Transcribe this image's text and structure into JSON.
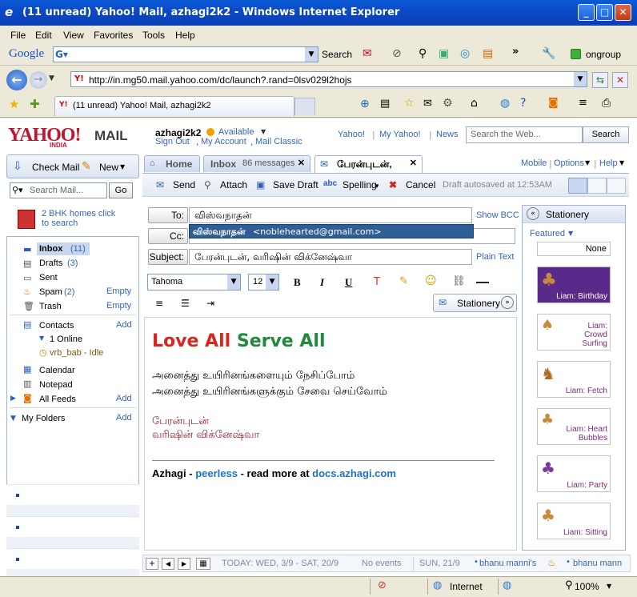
{
  "window": {
    "title": "(11 unread) Yahoo! Mail, azhagi2k2 - Windows Internet Explorer",
    "minimize": "_",
    "maximize": "□",
    "close": "✕"
  },
  "menu": [
    "File",
    "Edit",
    "View",
    "Favorites",
    "Tools",
    "Help"
  ],
  "googlebar": {
    "logo": "Google",
    "search_label": "Search",
    "more": "»",
    "ongroup": "ongroup"
  },
  "address": {
    "url": "http://in.mg50.mail.yahoo.com/dc/launch?.rand=0lsv029l2hojs"
  },
  "tabtitle": "(11 unread) Yahoo! Mail, azhagi2k2",
  "yahoo": {
    "logo": "YAHOO!",
    "logo_sub": "INDIA",
    "mail": "MAIL",
    "user": "azhagi2k2",
    "status": "Available",
    "links": [
      "Sign Out",
      "My Account",
      "Mail Classic"
    ],
    "top_links": [
      "Yahoo!",
      "My Yahoo!",
      "News"
    ],
    "search_placeholder": "Search the Web...",
    "search_btn": "Search"
  },
  "left": {
    "check_mail": "Check Mail",
    "new": "New",
    "search_placeholder": "Search Mail...",
    "go": "Go",
    "ad_line1": "2 BHK homes click",
    "ad_line2": "to search",
    "folders": [
      {
        "name": "Inbox",
        "count": "(11)"
      },
      {
        "name": "Drafts",
        "count": "(3)"
      },
      {
        "name": "Sent",
        "count": ""
      },
      {
        "name": "Spam",
        "count": "(2)",
        "action": "Empty"
      },
      {
        "name": "Trash",
        "count": "",
        "action": "Empty"
      }
    ],
    "contacts": "Contacts",
    "add": "Add",
    "online": "1 Online",
    "buddy": "vrb_bab - Idle",
    "calendar": "Calendar",
    "notepad": "Notepad",
    "feeds": "All Feeds",
    "myfolders": "My Folders"
  },
  "tabs": {
    "home": "Home",
    "inbox": "Inbox",
    "inbox_count": "86 messages",
    "compose": "பேரன்புடன்,"
  },
  "rightlinks": [
    "Mobile",
    "Options",
    "Help"
  ],
  "toolbar": {
    "send": "Send",
    "attach": "Attach",
    "save": "Save Draft",
    "spelling": "Spelling",
    "cancel": "Cancel",
    "autosave": "Draft autosaved at 12:53AM"
  },
  "compose": {
    "to_label": "To:",
    "to_value": "விஸ்வநாதன்",
    "show_bcc": "Show BCC",
    "cc_label": "Cc:",
    "suggest_name": "விஸ்வநாதன்",
    "suggest_email": "<noblehearted@gmail.com>",
    "subject_label": "Subject:",
    "subject_value": "பேரன்புடன், வரிஷின் விக்னேஷ்வா",
    "plain_text": "Plain Text",
    "font": "Tahoma",
    "size": "12",
    "stationery": "Stationery"
  },
  "body": {
    "love": "Love All",
    "serve": "Serve All",
    "line1": "அனைத்து உயிரினங்களையும் நேசிப்போம்",
    "line2": "அனைத்து உயிரினங்களுக்கும் சேவை செய்வோம்",
    "sig1": "பேரன்புடன்",
    "sig2": "வரிஷின் விக்னேஷ்வா",
    "foot_a": "Azhagi",
    "foot_sep1": " - ",
    "foot_b": "peerless",
    "foot_c": " - read more at ",
    "foot_d": "docs.azhagi.com"
  },
  "stationery": {
    "title": "Stationery",
    "featured": "Featured",
    "none": "None",
    "items": [
      "Liam: Birthday",
      "Liam: Crowd Surfing",
      "Liam: Fetch",
      "Liam: Heart Bubbles",
      "Liam: Party",
      "Liam: Sitting"
    ]
  },
  "calendar_bar": {
    "today": "TODAY: WED, 3/9 - SAT, 20/9",
    "events": "No events",
    "sun": "SUN, 21/9",
    "b1": "bhanu manni's",
    "b2": "bhanu mann"
  },
  "status": {
    "zone": "Internet",
    "zoom": "100%"
  }
}
